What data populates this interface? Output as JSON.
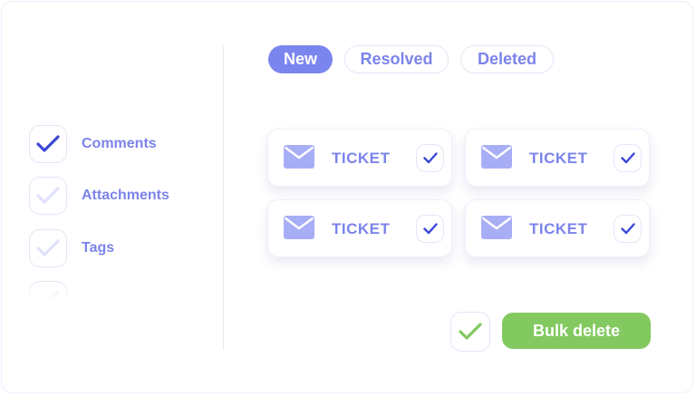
{
  "options": [
    {
      "label": "Comments",
      "checked": true
    },
    {
      "label": "Attachments",
      "checked": true
    },
    {
      "label": "Tags",
      "checked": true
    },
    {
      "label": "",
      "checked": true
    }
  ],
  "tabs": [
    {
      "label": "New",
      "active": true
    },
    {
      "label": "Resolved",
      "active": false
    },
    {
      "label": "Deleted",
      "active": false
    }
  ],
  "tickets": [
    {
      "label": "TICKET",
      "icon": "mail-icon",
      "checked": true
    },
    {
      "label": "TICKET",
      "icon": "mail-icon",
      "checked": true
    },
    {
      "label": "TICKET",
      "icon": "mail-icon",
      "checked": true
    },
    {
      "label": "TICKET",
      "icon": "mail-icon",
      "checked": true
    }
  ],
  "bulk": {
    "label": "Bulk delete",
    "checked": true
  },
  "colors": {
    "accent": "#7b85ee",
    "check_dark": "#3b47d6",
    "check_light": "#c9cdf7",
    "success": "#82c960",
    "envelope": "#a8aef5"
  }
}
